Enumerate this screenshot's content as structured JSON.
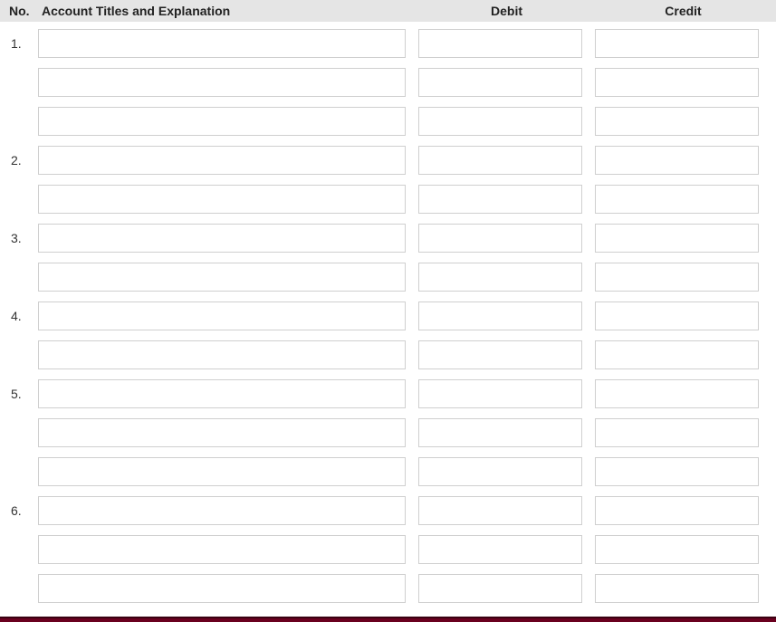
{
  "header": {
    "no": "No.",
    "account": "Account Titles and Explanation",
    "debit": "Debit",
    "credit": "Credit"
  },
  "rows": [
    {
      "num": "1.",
      "account": "",
      "debit": "",
      "credit": ""
    },
    {
      "num": "",
      "account": "",
      "debit": "",
      "credit": ""
    },
    {
      "num": "",
      "account": "",
      "debit": "",
      "credit": ""
    },
    {
      "num": "2.",
      "account": "",
      "debit": "",
      "credit": ""
    },
    {
      "num": "",
      "account": "",
      "debit": "",
      "credit": ""
    },
    {
      "num": "3.",
      "account": "",
      "debit": "",
      "credit": ""
    },
    {
      "num": "",
      "account": "",
      "debit": "",
      "credit": ""
    },
    {
      "num": "4.",
      "account": "",
      "debit": "",
      "credit": ""
    },
    {
      "num": "",
      "account": "",
      "debit": "",
      "credit": ""
    },
    {
      "num": "5.",
      "account": "",
      "debit": "",
      "credit": ""
    },
    {
      "num": "",
      "account": "",
      "debit": "",
      "credit": ""
    },
    {
      "num": "",
      "account": "",
      "debit": "",
      "credit": ""
    },
    {
      "num": "6.",
      "account": "",
      "debit": "",
      "credit": ""
    },
    {
      "num": "",
      "account": "",
      "debit": "",
      "credit": ""
    },
    {
      "num": "",
      "account": "",
      "debit": "",
      "credit": ""
    }
  ]
}
